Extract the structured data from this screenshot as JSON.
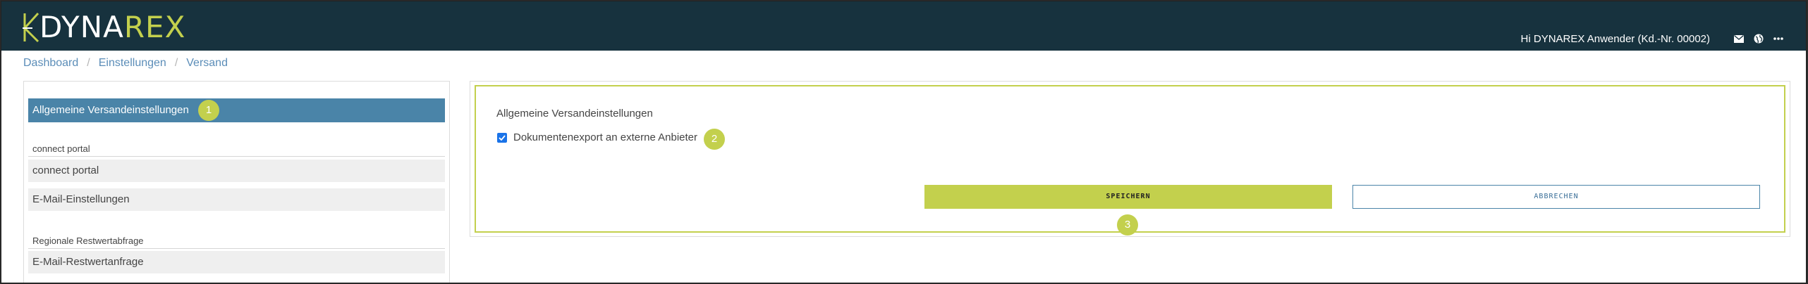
{
  "app": {
    "logo_dyna": "DYNA",
    "logo_rex": "REX"
  },
  "header": {
    "greeting": "Hi DYNAREX Anwender (Kd.-Nr. 00002)",
    "icons": [
      "mail-icon",
      "globe-icon",
      "more-icon"
    ]
  },
  "breadcrumb": {
    "items": [
      "Dashboard",
      "Einstellungen",
      "Versand"
    ],
    "separator": "/"
  },
  "sidebar": {
    "active_item": "Allgemeine Versandeinstellungen",
    "groups": [
      {
        "label": "connect portal",
        "items": [
          "connect portal",
          "E-Mail-Einstellungen"
        ]
      },
      {
        "label": "Regionale Restwertabfrage",
        "items": [
          "E-Mail-Restwertanfrage"
        ]
      }
    ]
  },
  "main": {
    "section_title": "Allgemeine Versandeinstellungen",
    "checkbox": {
      "label": "Dokumentenexport an externe Anbieter",
      "checked": true
    },
    "save_label": "SPEICHERN",
    "cancel_label": "ABBRECHEN"
  },
  "badges": [
    "1",
    "2",
    "3"
  ],
  "colors": {
    "topbar": "#17323e",
    "accent": "#c3d04d",
    "active_nav": "#4a84a8",
    "link": "#5b8db8"
  }
}
